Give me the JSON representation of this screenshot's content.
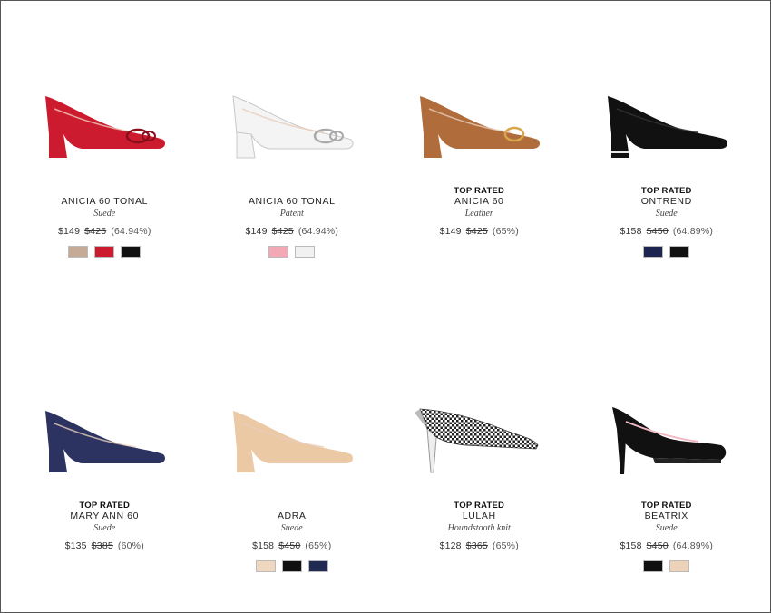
{
  "products": [
    {
      "badge": "",
      "name": "ANICIA 60 TONAL",
      "material": "Suede",
      "price": "$149",
      "original": "$425",
      "discount": "(64.94%)",
      "shoe_color": "#cc1b2e",
      "swatches": [
        "#c6aa98",
        "#cc1b2e",
        "#111111"
      ],
      "icon": "pump-with-bow-icon"
    },
    {
      "badge": "",
      "name": "ANICIA 60 TONAL",
      "material": "Patent",
      "price": "$149",
      "original": "$425",
      "discount": "(64.94%)",
      "shoe_color": "#f4f4f4",
      "swatches": [
        "#f4a8b6",
        "#f1f1f1"
      ],
      "icon": "pump-with-bow-icon"
    },
    {
      "badge": "TOP RATED",
      "name": "ANICIA 60",
      "material": "Leather",
      "price": "$149",
      "original": "$425",
      "discount": "(65%)",
      "shoe_color": "#b06c3a",
      "swatches": [],
      "icon": "pump-with-buckle-icon"
    },
    {
      "badge": "TOP RATED",
      "name": "ONTREND",
      "material": "Suede",
      "price": "$158",
      "original": "$450",
      "discount": "(64.89%)",
      "shoe_color": "#111111",
      "swatches": [
        "#1b2550",
        "#111111"
      ],
      "icon": "block-heel-pump-icon"
    },
    {
      "badge": "TOP RATED",
      "name": "MARY ANN 60",
      "material": "Suede",
      "price": "$135",
      "original": "$385",
      "discount": "(60%)",
      "shoe_color": "#2c3361",
      "swatches": [],
      "icon": "block-heel-pump-icon"
    },
    {
      "badge": "",
      "name": "ADRA",
      "material": "Suede",
      "price": "$158",
      "original": "$450",
      "discount": "(65%)",
      "shoe_color": "#ecc9a5",
      "swatches": [
        "#efd8bf",
        "#111111",
        "#1e2a52"
      ],
      "icon": "block-heel-pump-icon"
    },
    {
      "badge": "TOP RATED",
      "name": "LULAH",
      "material": "Houndstooth knit",
      "price": "$128",
      "original": "$365",
      "discount": "(65%)",
      "shoe_color": "#222222",
      "swatches": [],
      "icon": "houndstooth-mule-icon"
    },
    {
      "badge": "TOP RATED",
      "name": "BEATRIX",
      "material": "Suede",
      "price": "$158",
      "original": "$450",
      "discount": "(64.89%)",
      "shoe_color": "#111111",
      "swatches": [
        "#111111",
        "#ecd2b9"
      ],
      "icon": "platform-stiletto-pump-icon"
    }
  ]
}
